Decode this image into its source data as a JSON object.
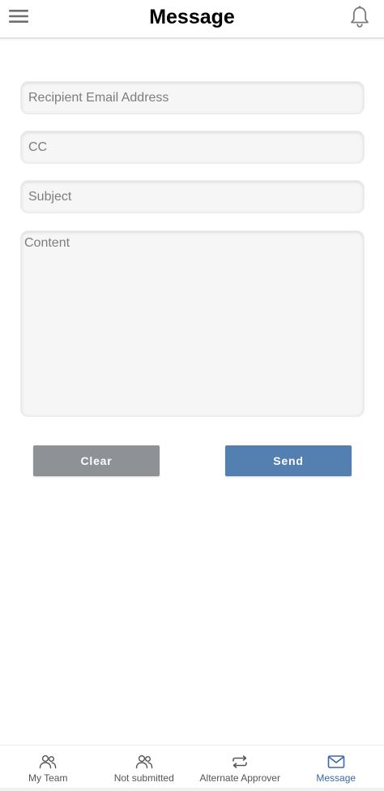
{
  "header": {
    "title": "Message",
    "menu_icon": "hamburger-menu-icon",
    "notification_icon": "bell-icon"
  },
  "form": {
    "recipient_placeholder": "Recipient Email Address",
    "recipient_value": "",
    "cc_placeholder": "CC",
    "cc_value": "",
    "subject_placeholder": "Subject",
    "subject_value": "",
    "content_placeholder": "Content",
    "content_value": ""
  },
  "actions": {
    "clear_label": "Clear",
    "send_label": "Send",
    "clear_color": "#8e9196",
    "send_color": "#547fb1"
  },
  "bottom_nav": {
    "active_color": "#3a67a8",
    "items": [
      {
        "label": "My Team",
        "icon": "team-icon",
        "active": false
      },
      {
        "label": "Not submitted",
        "icon": "users-icon",
        "active": false
      },
      {
        "label": "Alternate Approver",
        "icon": "swap-arrows-icon",
        "active": false
      },
      {
        "label": "Message",
        "icon": "mail-icon",
        "active": true
      }
    ]
  }
}
